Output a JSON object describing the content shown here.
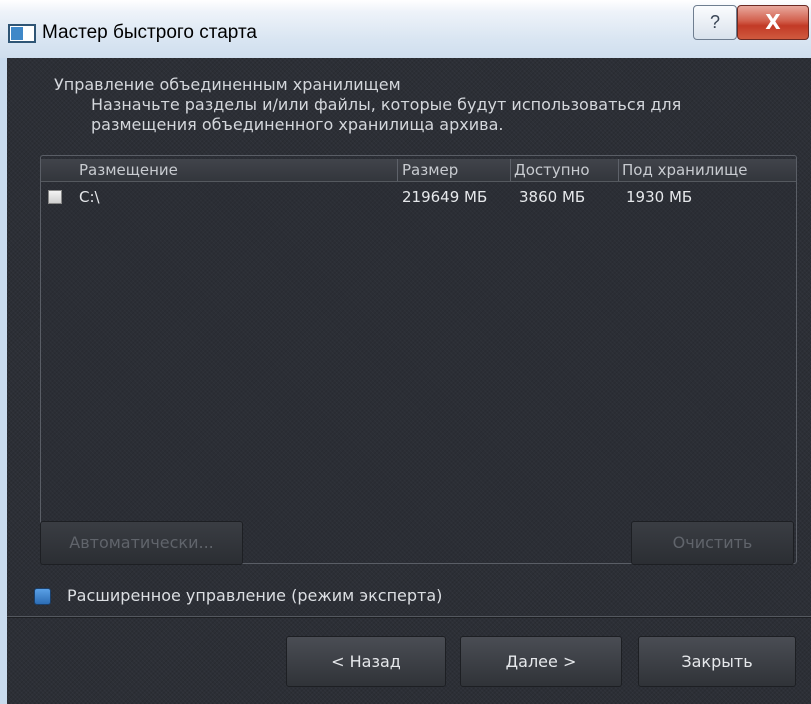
{
  "window": {
    "title": "Мастер быстрого старта",
    "help_label": "?",
    "close_label": "X"
  },
  "header": {
    "title": "Управление объединенным хранилищем",
    "description": "Назначьте разделы и/или файлы, которые будут использоваться для размещения объединенного хранилища архива."
  },
  "table": {
    "columns": [
      "Размещение",
      "Размер",
      "Доступно",
      "Под хранилище"
    ],
    "rows": [
      {
        "checked": false,
        "location": "C:\\",
        "size": "219649 МБ",
        "available": "3860 МБ",
        "storage": "1930 МБ"
      }
    ]
  },
  "actions": {
    "auto_label": "Автоматически...",
    "clear_label": "Очистить"
  },
  "expert_mode": {
    "label": "Расширенное управление (режим эксперта)",
    "checked": true
  },
  "footer": {
    "back_label": "< Назад",
    "next_label": "Далее >",
    "close_label": "Закрыть"
  },
  "colors": {
    "background": "#2c2f36",
    "text": "#d4d7dc",
    "disabled_text": "#60646b",
    "accent_checkbox": "#3f88d8",
    "close_button": "#c23a26"
  }
}
